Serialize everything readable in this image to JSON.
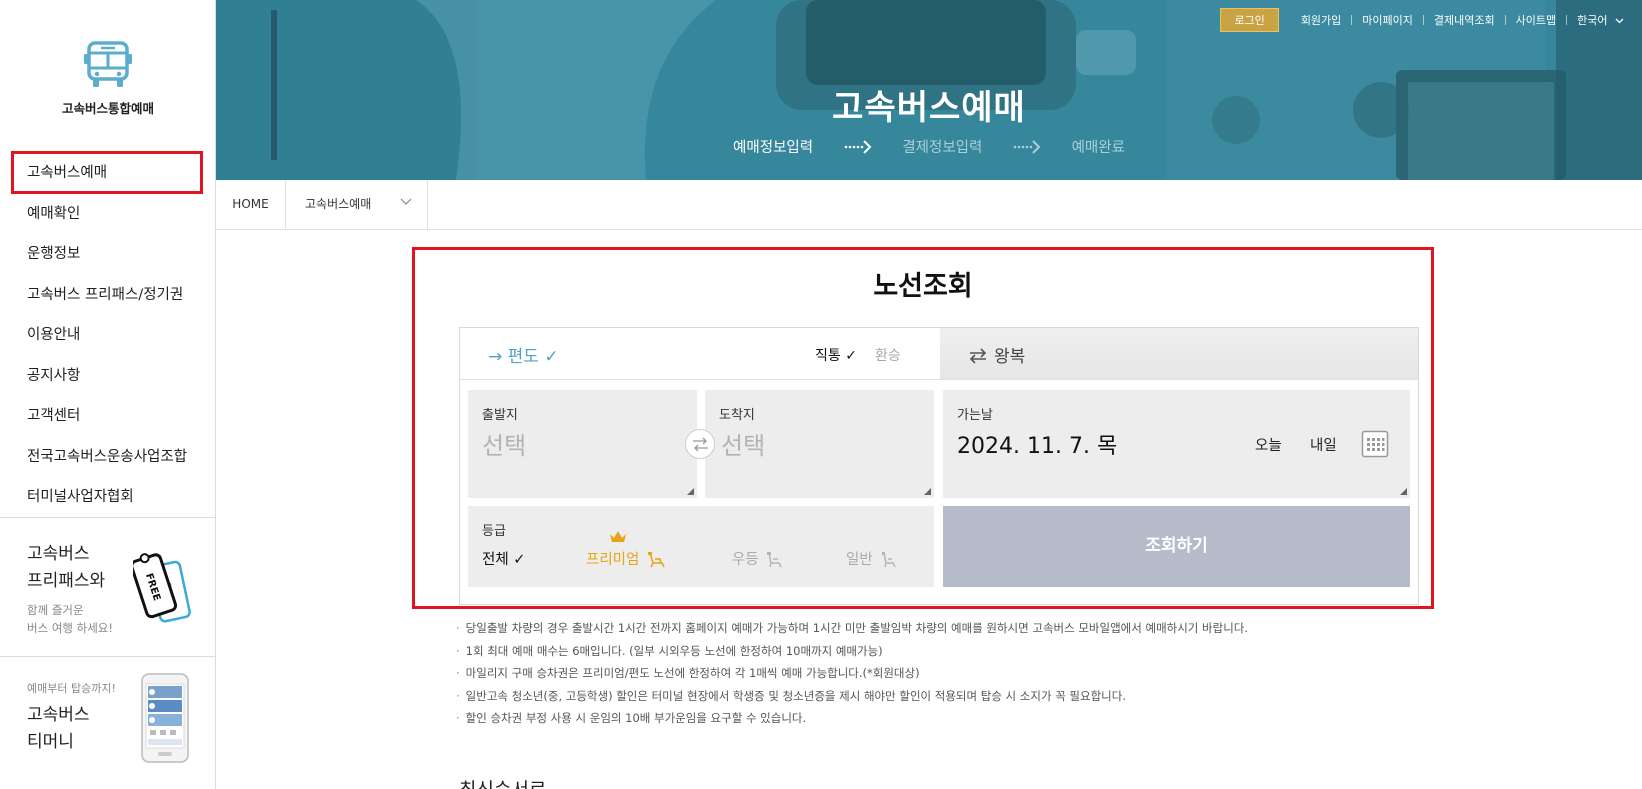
{
  "header": {
    "title": "고속버스예매",
    "steps": [
      "예매정보입력",
      "결제정보입력",
      "예매완료"
    ],
    "top_links": {
      "login": "로그인",
      "join": "회원가입",
      "mypage": "마이페이지",
      "payment_history": "결제내역조회",
      "sitemap": "사이트맵",
      "language": "한국어"
    }
  },
  "sidebar": {
    "logo_text": "고속버스통합예매",
    "items": [
      {
        "label": "고속버스예매"
      },
      {
        "label": "예매확인"
      },
      {
        "label": "운행정보"
      },
      {
        "label": "고속버스 프리패스/정기권"
      },
      {
        "label": "이용안내"
      },
      {
        "label": "공지사항"
      },
      {
        "label": "고객센터"
      },
      {
        "label": "전국고속버스운송사업조합"
      },
      {
        "label": "터미널사업자협회"
      }
    ],
    "promo_freepass": {
      "title_line1": "고속버스",
      "title_line2": "프리패스와",
      "sub_line1": "함께 즐거운",
      "sub_line2": "버스 여행 하세요!",
      "badge": "FREE"
    },
    "promo_tmoney": {
      "kicker": "예매부터 탑승까지!",
      "title_line1": "고속버스",
      "title_line2": "티머니"
    }
  },
  "breadcrumb": {
    "home": "HOME",
    "current": "고속버스예매"
  },
  "route_search": {
    "title": "노선조회",
    "oneway_label": "→ 편도 ✓",
    "direct_label": "직통 ✓",
    "transfer_label": "환승",
    "roundtrip_label": "왕복",
    "departure": {
      "label": "출발지",
      "placeholder": "선택"
    },
    "arrival": {
      "label": "도착지",
      "placeholder": "선택"
    },
    "date": {
      "label": "가는날",
      "value": "2024. 11. 7. 목",
      "today": "오늘",
      "tomorrow": "내일"
    },
    "grade": {
      "label": "등급",
      "options": [
        "전체 ✓",
        "프리미엄",
        "우등",
        "일반"
      ]
    },
    "search_button": "조회하기"
  },
  "notices": [
    "당일출발 차량의 경우 출발시간 1시간 전까지 홈페이지 예매가 가능하며 1시간 미만 출발임박 차량의 예매를 원하시면 고속버스 모바일앱에서 예매하시기 바랍니다.",
    "1회 최대 예매 매수는 6매입니다. (일부 시외우등 노선에 한정하여 10매까지 예매가능)",
    "마일리지 구매 승차권은 프리미엄/편도 노선에 한정하여 각 1매씩 예매 가능합니다.(*회원대상)",
    "일반고속 청소년(중, 고등학생) 할인은 터미널 현장에서 학생증 및 청소년증을 제시 해야만 할인이 적용되며 탑승 시 소지가 꼭 필요합니다.",
    "할인 승차권 부정 사용 시 운임의 10배 부가운임을 요구할 수 있습니다."
  ],
  "recent_title": "최신순서로",
  "colors": {
    "accent_blue": "#55a3c2",
    "highlight_red": "#e0141e",
    "premium_gold": "#e7a514",
    "login_gold": "#c9a344",
    "search_button": "#b5bbc9"
  }
}
